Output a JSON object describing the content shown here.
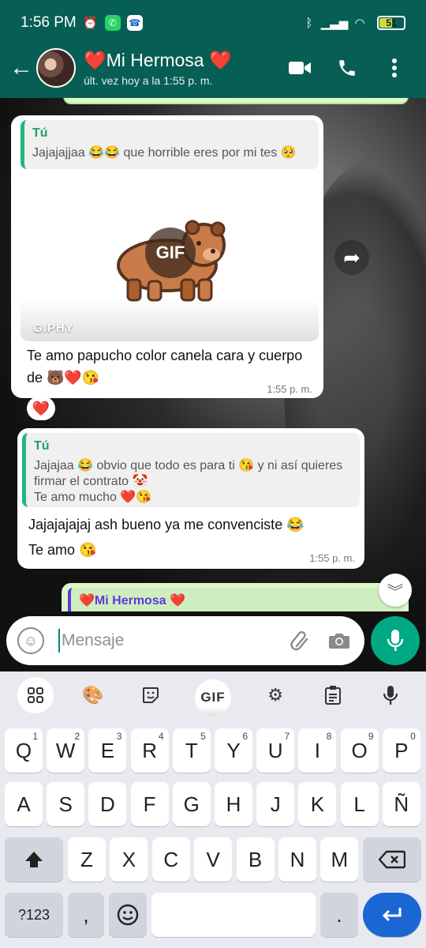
{
  "status_bar": {
    "time": "1:56 PM",
    "battery_level": "51",
    "battery_fraction": 0.51,
    "icons": [
      "alarm-icon",
      "whatsapp-icon",
      "phone-call-icon",
      "bluetooth-icon",
      "signal-icon",
      "wifi-icon",
      "battery-icon"
    ]
  },
  "header": {
    "contact_name": "❤️Mi Hermosa ❤️",
    "last_seen": "últ. vez hoy a la 1:55 p. m.",
    "icons": [
      "back-arrow-icon",
      "video-call-icon",
      "voice-call-icon",
      "more-vert-icon"
    ]
  },
  "messages": [
    {
      "type": "incoming",
      "quote_author": "Tú",
      "quote_text": "Jajajajjaa 😂😂 que horrible eres por mi tes 🥺",
      "gif_label": "GIF",
      "gif_provider": "GIPHY",
      "text": "Te amo papucho color canela cara y cuerpo de 🐻❤️😘",
      "time": "1:55 p. m.",
      "reaction": "❤️"
    },
    {
      "type": "incoming",
      "quote_author": "Tú",
      "quote_text": "Jajajaa 😂 obvio que todo es para ti 😘 y ni así quieres firmar el contrato 🤡\nTe amo mucho ❤️😘",
      "text_line1": "Jajajajajaj ash bueno ya me convenciste 😂",
      "text_line2": "Te amo 😘",
      "time": "1:55 p. m."
    },
    {
      "type": "outgoing",
      "quote_author": "❤️Mi Hermosa ❤️"
    }
  ],
  "composer": {
    "placeholder": "Mensaje"
  },
  "keyboard": {
    "toolbar": [
      "apps-grid-icon",
      "palette-icon",
      "sticker-icon",
      "GIF",
      "settings-icon",
      "clipboard-icon",
      "mic-icon"
    ],
    "gif_label": "GIF",
    "row1": [
      {
        "k": "Q",
        "n": "1"
      },
      {
        "k": "W",
        "n": "2"
      },
      {
        "k": "E",
        "n": "3"
      },
      {
        "k": "R",
        "n": "4"
      },
      {
        "k": "T",
        "n": "5"
      },
      {
        "k": "Y",
        "n": "6"
      },
      {
        "k": "U",
        "n": "7"
      },
      {
        "k": "I",
        "n": "8"
      },
      {
        "k": "O",
        "n": "9"
      },
      {
        "k": "P",
        "n": "0"
      }
    ],
    "row2": [
      "A",
      "S",
      "D",
      "F",
      "G",
      "H",
      "J",
      "K",
      "L",
      "Ñ"
    ],
    "row3": [
      "Z",
      "X",
      "C",
      "V",
      "B",
      "N",
      "M"
    ],
    "symbols_label": "?123",
    "comma": ",",
    "period": "."
  }
}
